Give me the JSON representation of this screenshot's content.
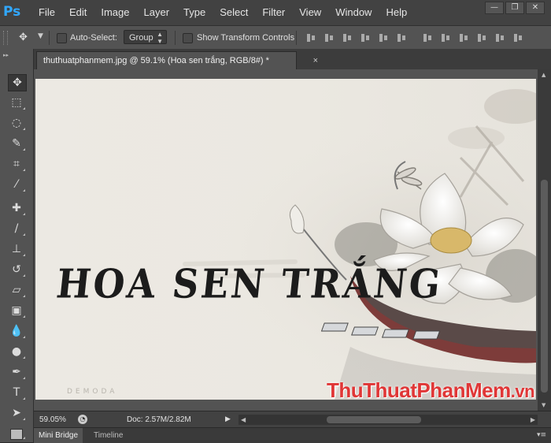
{
  "app": {
    "logo": "Ps"
  },
  "menu": [
    "File",
    "Edit",
    "Image",
    "Layer",
    "Type",
    "Select",
    "Filter",
    "View",
    "Window",
    "Help"
  ],
  "window_controls": {
    "minimize": "—",
    "restore": "❐",
    "close": "✕"
  },
  "options": {
    "auto_select_label": "Auto-Select:",
    "auto_select_checked": false,
    "group_value": "Group",
    "show_transform_label": "Show Transform Controls",
    "show_transform_checked": false
  },
  "document": {
    "tab_title": "thuthuatphanmem.jpg @ 59.1% (Hoa sen trắng, RGB/8#) *",
    "close_glyph": "×",
    "image_text": "HOA SEN TRẮNG",
    "signature": "DEMODA",
    "watermark_main": "ThuThuatPhanMem",
    "watermark_tld": ".vn"
  },
  "status": {
    "zoom": "59.05%",
    "doc_size": "Doc: 2.57M/2.82M"
  },
  "panels": [
    {
      "label": "Mini Bridge",
      "active": true
    },
    {
      "label": "Timeline",
      "active": false
    }
  ],
  "colors": {
    "accent": "#31a8ff",
    "watermark": "#e03636",
    "canvas_bg": "#ece9e3"
  },
  "tools": [
    {
      "name": "move-tool-icon",
      "glyph": "✥"
    },
    {
      "name": "marquee-tool-icon",
      "glyph": "⬚"
    },
    {
      "name": "lasso-tool-icon",
      "glyph": "◌"
    },
    {
      "name": "quick-selection-tool-icon",
      "glyph": "✎"
    },
    {
      "name": "crop-tool-icon",
      "glyph": "⌗"
    },
    {
      "name": "eyedropper-tool-icon",
      "glyph": "⁄"
    },
    {
      "name": "healing-brush-tool-icon",
      "glyph": "✚"
    },
    {
      "name": "brush-tool-icon",
      "glyph": "/"
    },
    {
      "name": "clone-stamp-tool-icon",
      "glyph": "⊥"
    },
    {
      "name": "history-brush-tool-icon",
      "glyph": "↺"
    },
    {
      "name": "eraser-tool-icon",
      "glyph": "▱"
    },
    {
      "name": "gradient-tool-icon",
      "glyph": "▣"
    },
    {
      "name": "blur-tool-icon",
      "glyph": "💧"
    },
    {
      "name": "dodge-tool-icon",
      "glyph": "●"
    },
    {
      "name": "pen-tool-icon",
      "glyph": "✒"
    },
    {
      "name": "type-tool-icon",
      "glyph": "T"
    },
    {
      "name": "path-selection-tool-icon",
      "glyph": "➤"
    },
    {
      "name": "shape-tool-icon",
      "glyph": "▭"
    }
  ]
}
